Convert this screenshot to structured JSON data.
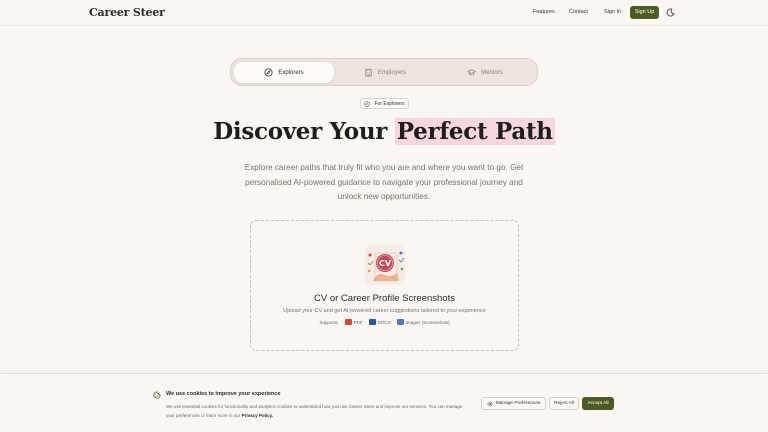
{
  "header": {
    "brand": "Career Steer",
    "nav": [
      "Features",
      "Contact",
      "Sign In"
    ],
    "signup": "Sign Up",
    "theme_icon": "moon-icon"
  },
  "tabs": [
    {
      "label": "Explorers",
      "icon": "compass-icon",
      "active": true
    },
    {
      "label": "Employers",
      "icon": "building-icon",
      "active": false
    },
    {
      "label": "Mentors",
      "icon": "graduation-cap-icon",
      "active": false
    }
  ],
  "badge": "For Explorers",
  "hero": {
    "title_plain": "Discover Your",
    "title_highlight": "Perfect Path",
    "subtitle": "Explore career paths that truly fit who you are and where you want to go. Get personalised AI-powered guidance to navigate your professional journey and unlock new opportunities."
  },
  "upload": {
    "title": "CV or Career Profile Screenshots",
    "description": "Upload your CV and get AI-powered career suggestions tailored to your experience",
    "supports_label": "Supports:",
    "formats": [
      {
        "label": "PDF",
        "color": "#d9482b"
      },
      {
        "label": "DOCX",
        "color": "#2b5797"
      },
      {
        "label": "Images (Screenshots)",
        "color": "#4a7bd0"
      }
    ]
  },
  "cookie": {
    "title": "We use cookies to improve your experience",
    "text": "We use essential cookies for functionality and analytics cookies to understand how you use Career Steer and improve our services. You can manage your preferences or learn more in our",
    "policy_link": "Privacy Policy.",
    "manage": "Manage Preferences",
    "reject": "Reject All",
    "accept": "Accept All"
  },
  "colors": {
    "background": "#faf6f2",
    "primary": "#4e5a24",
    "highlight": "#f7d6dd"
  }
}
